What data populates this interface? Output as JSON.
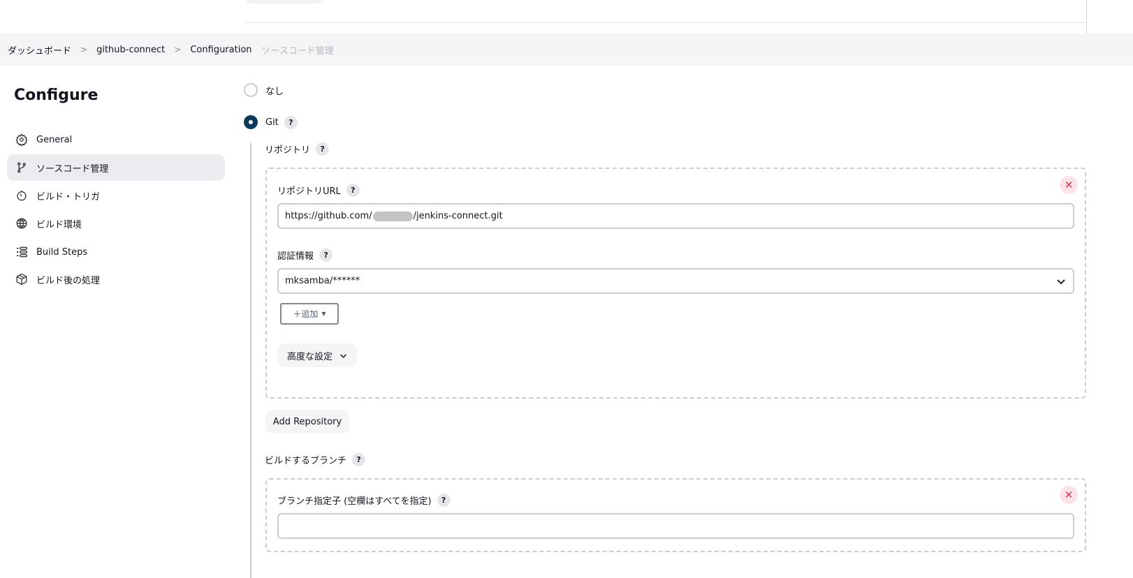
{
  "breadcrumb": {
    "items": [
      "ダッシュボード",
      "github-connect",
      "Configuration"
    ],
    "current": "ソースコード管理"
  },
  "sidebar": {
    "title": "Configure",
    "items": [
      {
        "label": "General",
        "icon": "gear-icon"
      },
      {
        "label": "ソースコード管理",
        "icon": "branch-icon",
        "active": true
      },
      {
        "label": "ビルド・トリガ",
        "icon": "timer-icon"
      },
      {
        "label": "ビルド環境",
        "icon": "globe-icon"
      },
      {
        "label": "Build Steps",
        "icon": "list-icon"
      },
      {
        "label": "ビルド後の処理",
        "icon": "package-icon"
      }
    ]
  },
  "scm": {
    "none_label": "なし",
    "git_label": "Git",
    "help": "?",
    "repositories_label": "リポジトリ",
    "repo_url_label": "リポジトリURL",
    "repo_url_prefix": "https://github.com/",
    "repo_url_suffix": "/jenkins-connect.git",
    "credentials_label": "認証情報",
    "credentials_value": "mksamba/******",
    "add_label": "＋追加",
    "advanced_label": "高度な設定",
    "add_repository_label": "Add Repository",
    "branches_label": "ビルドするブランチ",
    "branch_specifier_label": "ブランチ指定子 (空欄はすべてを指定)",
    "branch_specifier_value": ""
  },
  "colors": {
    "accent": "#0b3b5c",
    "danger": "#e2374c"
  }
}
